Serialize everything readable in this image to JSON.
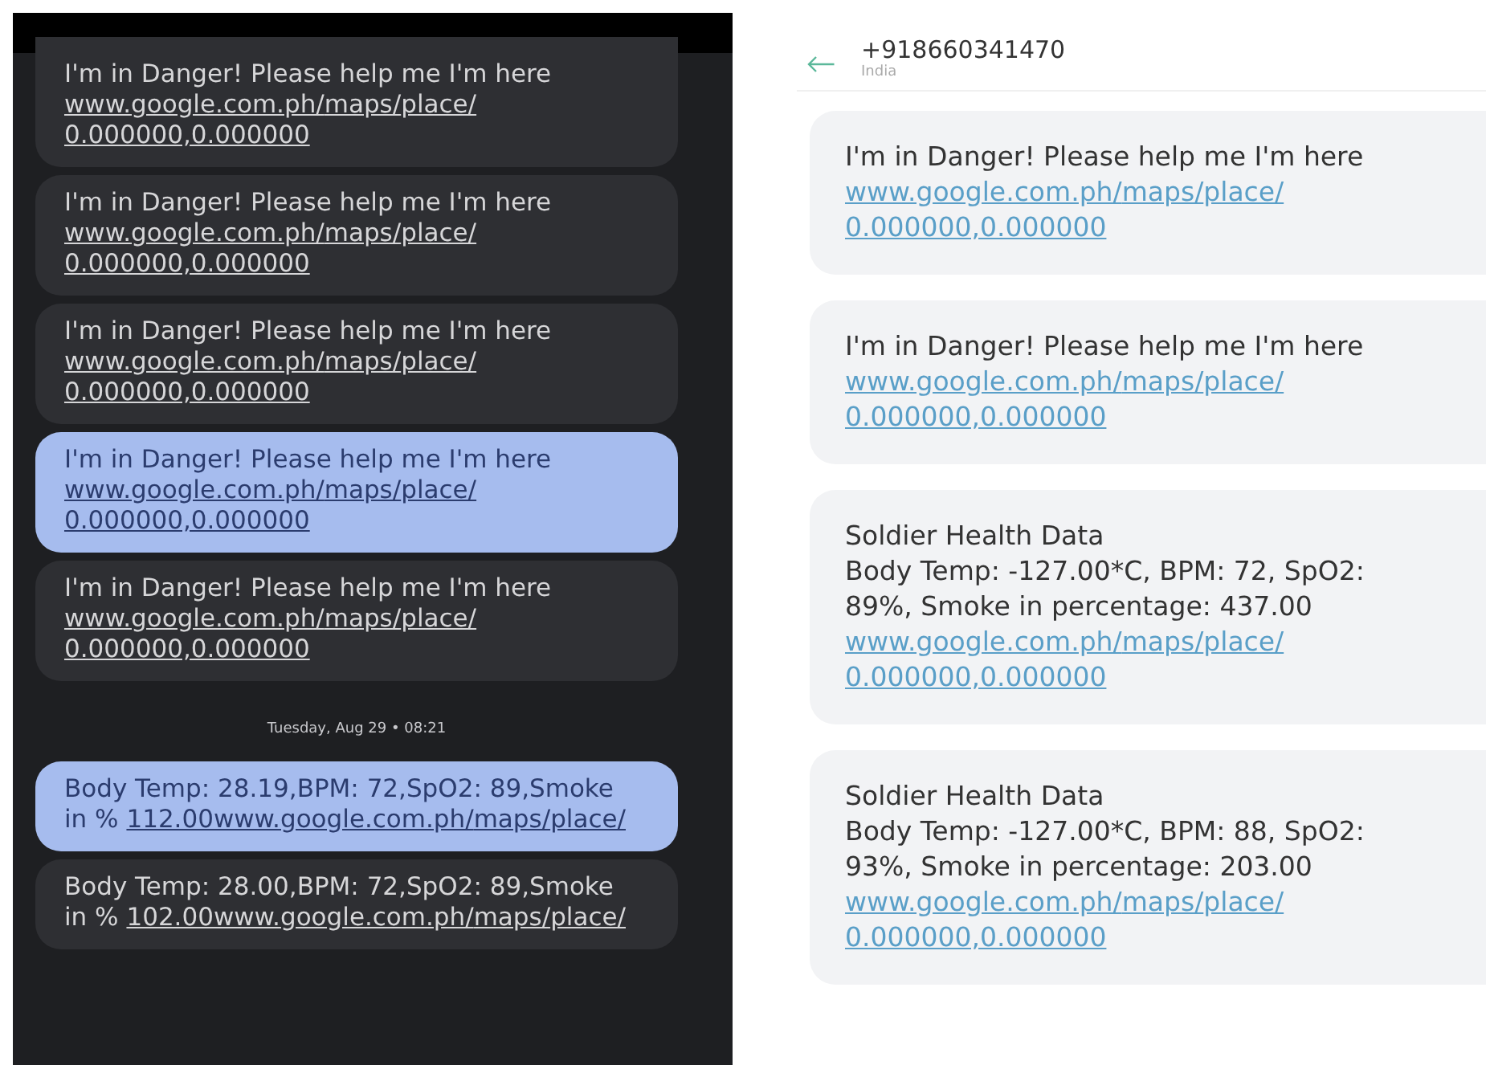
{
  "left_chat": {
    "items": [
      {
        "kind": "message",
        "text": "I'm in Danger! Please help me I'm here",
        "link": "www.google.com.ph/maps/place/0.000000,0.000000",
        "selected": false
      },
      {
        "kind": "message",
        "text": "I'm in Danger! Please help me I'm here",
        "link": "www.google.com.ph/maps/place/0.000000,0.000000",
        "selected": false
      },
      {
        "kind": "message",
        "text": "I'm in Danger! Please help me I'm here",
        "link": "www.google.com.ph/maps/place/0.000000,0.000000",
        "selected": false
      },
      {
        "kind": "message",
        "text": "I'm in Danger! Please help me I'm here",
        "link": "www.google.com.ph/maps/place/0.000000,0.000000",
        "selected": true
      },
      {
        "kind": "message",
        "text": "I'm in Danger! Please help me I'm here",
        "link": "www.google.com.ph/maps/place/0.000000,0.000000",
        "selected": false
      },
      {
        "kind": "date",
        "text": "Tuesday, Aug 29 • 08:21"
      },
      {
        "kind": "message",
        "text": "Body Temp: 28.19,BPM: 72,SpO2: 89,Smoke in %",
        "link": "112.00www.google.com.ph/maps/place/",
        "selected": true
      },
      {
        "kind": "message",
        "text": "Body Temp: 28.00,BPM: 72,SpO2: 89,Smoke in %",
        "link": "102.00www.google.com.ph/maps/place/",
        "selected": false
      }
    ]
  },
  "right_chat": {
    "header": {
      "title": "+918660341470",
      "subtitle": "India"
    },
    "messages": [
      {
        "kind": "alert",
        "lines": [
          "I'm in Danger! Please help me I'm here"
        ],
        "link": "www.google.com.ph/maps/place/0.000000,0.000000"
      },
      {
        "kind": "alert",
        "lines": [
          "I'm in Danger! Please help me I'm here"
        ],
        "link": "www.google.com.ph/maps/place/0.000000,0.000000"
      },
      {
        "kind": "health",
        "lines": [
          "Soldier Health Data",
          "Body Temp: -127.00*C, BPM: 72, SpO2: 89%, Smoke in percentage: 437.00"
        ],
        "link": "www.google.com.ph/maps/place/0.000000,0.000000"
      },
      {
        "kind": "health",
        "lines": [
          "Soldier Health Data",
          "Body Temp: -127.00*C, BPM: 88, SpO2: 93%, Smoke in percentage: 203.00"
        ],
        "link": "www.google.com.ph/maps/place/0.000000,0.000000"
      }
    ]
  }
}
